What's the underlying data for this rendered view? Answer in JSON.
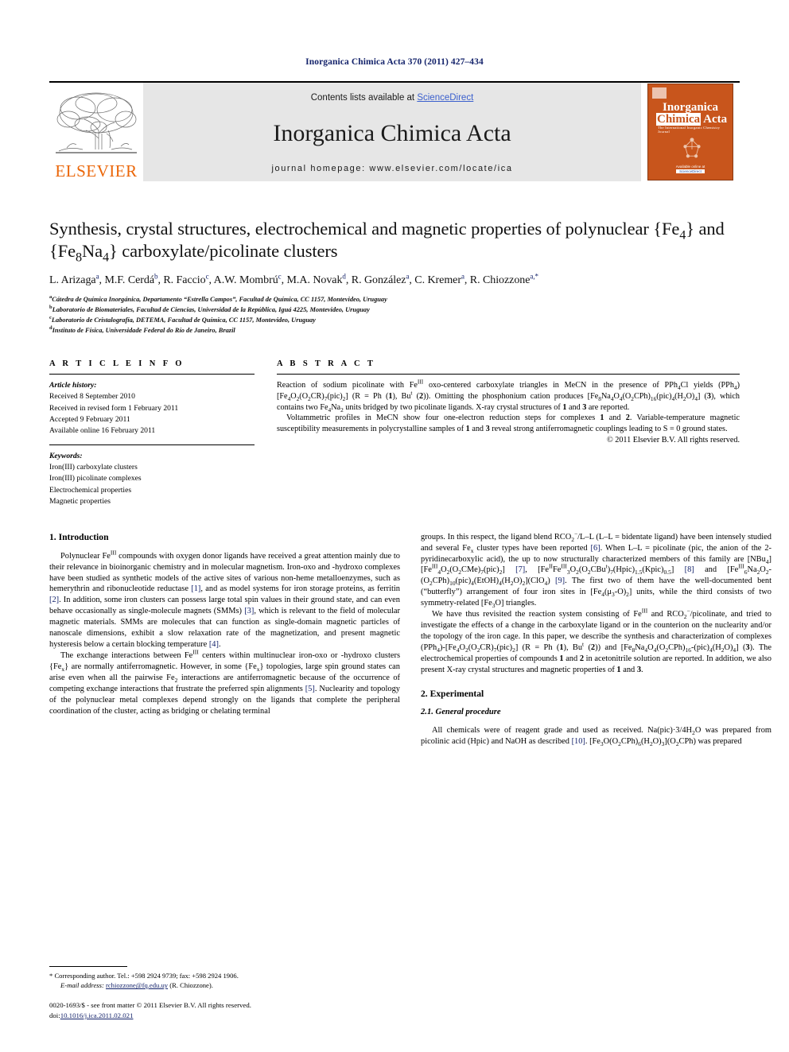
{
  "running_head": "Inorganica Chimica Acta 370 (2011) 427–434",
  "masthead": {
    "publisher": "ELSEVIER",
    "contents_prefix": "Contents lists available at ",
    "sciencedirect": "ScienceDirect",
    "journal_title": "Inorganica Chimica Acta",
    "homepage": "journal homepage: www.elsevier.com/locate/ica",
    "cover": {
      "line1": "Inorganica",
      "line2a": "Chimica",
      "line2b": "Acta",
      "tagline": "The International Inorganic Chemistry Journal",
      "available_at": "Available online at",
      "sd_box": "ScienceDirect"
    },
    "colors": {
      "banner_bg": "#e6e6e6",
      "elsevier_orange": "#eb6608",
      "sciencedirect_blue": "#3a5fcd",
      "cover_orange": "#c8551c",
      "link_navy": "#14236b"
    }
  },
  "title": "Synthesis, crystal structures, electrochemical and magnetic properties of polynuclear {Fe₄} and {Fe₈Na₄} carboxylate/picolinate clusters",
  "authors": [
    {
      "name": "L. Arizaga",
      "sup": "a"
    },
    {
      "name": "M.F. Cerdá",
      "sup": "b"
    },
    {
      "name": "R. Faccio",
      "sup": "c"
    },
    {
      "name": "A.W. Mombrú",
      "sup": "c"
    },
    {
      "name": "M.A. Novak",
      "sup": "d"
    },
    {
      "name": "R. González",
      "sup": "a"
    },
    {
      "name": "C. Kremer",
      "sup": "a"
    },
    {
      "name": "R. Chiozzone",
      "sup": "a,*"
    }
  ],
  "affiliations": [
    {
      "sup": "a",
      "text": "Cátedra de Química Inorgánica, Departamento “Estrella Campos”, Facultad de Química, CC 1157, Montevideo, Uruguay"
    },
    {
      "sup": "b",
      "text": "Laboratorio de Biomateriales, Facultad de Ciencias, Universidad de la República, Iguá 4225, Montevideo, Uruguay"
    },
    {
      "sup": "c",
      "text": "Laboratorio de Cristalografía, DETEMA, Facultad de Química, CC 1157, Montevideo, Uruguay"
    },
    {
      "sup": "d",
      "text": "Instituto de Física, Universidade Federal do Río de Janeiro, Brazil"
    }
  ],
  "article_info": {
    "heading": "A R T I C L E   I N F O",
    "history_label": "Article history:",
    "history": [
      "Received 8 September 2010",
      "Received in revised form 1 February 2011",
      "Accepted 9 February 2011",
      "Available online 16 February 2011"
    ],
    "keywords_label": "Keywords:",
    "keywords": [
      "Iron(III) carboxylate clusters",
      "Iron(III) picolinate complexes",
      "Electrochemical properties",
      "Magnetic properties"
    ]
  },
  "abstract": {
    "heading": "A B S T R A C T",
    "paragraph1": "Reaction of sodium picolinate with Feᴵᴵᴵ oxo-centered carboxylate triangles in MeCN in the presence of PPh₄Cl yields (PPh₄)[Fe₄O₂(O₂CR)₇(pic)₂] (R = Ph (1), Buᵗ (2)). Omitting the phosphonium cation produces [Fe₈Na₄O₄(O₂CPh)₁₆(pic)₄(H₂O)₄] (3), which contains two Fe₄Na₂ units bridged by two picolinate ligands. X-ray crystal structures of 1 and 3 are reported.",
    "paragraph2": "Voltammetric profiles in MeCN show four one-electron reduction steps for complexes 1 and 2. Variable-temperature magnetic susceptibility measurements in polycrystalline samples of 1 and 3 reveal strong antiferromagnetic couplings leading to S = 0 ground states.",
    "copyright": "© 2011 Elsevier B.V. All rights reserved."
  },
  "body": {
    "left": {
      "section_heading": "1. Introduction",
      "p1": "Polynuclear Feᴵᴵᴵ compounds with oxygen donor ligands have received a great attention mainly due to their relevance in bioinorganic chemistry and in molecular magnetism. Iron-oxo and -hydroxo complexes have been studied as synthetic models of the active sites of various non-heme metalloenzymes, such as hemerythrin and ribonucleotide reductase [1], and as model systems for iron storage proteins, as ferritin [2]. In addition, some iron clusters can possess large total spin values in their ground state, and can even behave occasionally as single-molecule magnets (SMMs) [3], which is relevant to the field of molecular magnetic materials. SMMs are molecules that can function as single-domain magnetic particles of nanoscale dimensions, exhibit a slow relaxation rate of the magnetization, and present magnetic hysteresis below a certain blocking temperature [4].",
      "p2": "The exchange interactions between Feᴵᴵᴵ centers within multinuclear iron-oxo or -hydroxo clusters {Feₓ} are normally antiferromagnetic. However, in some {Feₓ} topologies, large spin ground states can arise even when all the pairwise Fe₂ interactions are antiferromagnetic because of the occurrence of competing exchange interactions that frustrate the preferred spin alignments [5]. Nuclearity and topology of the polynuclear metal complexes depend strongly on the ligands that complete the peripheral coordination of the cluster, acting as bridging or chelating terminal"
    },
    "right": {
      "p1": "groups. In this respect, the ligand blend RCO₂⁻/L–L (L–L = bidentate ligand) have been intensely studied and several Feₓ cluster types have been reported [6]. When L–L = picolinate (pic, the anion of the 2-pyridinecarboxylic acid), the up to now structurally characterized members of this family are [NBu₄][Feᴵᴵᴵ₄O₂(O₂CMe)₇(pic)₂] [7], [FeᴵᴵFeᴵᴵᴵ₃O₂(O₂CBuᵗ)₇(Hpic)₁.₅(Kpic)₀.₅] [8] and [Feᴵᴵᴵ₆Na₂O₂(O₂CPh)₁₀(pic)₄(EtOH)₄(H₂O)₂](ClO₄) [9]. The first two of them have the well-documented bent (“butterfly”) arrangement of four iron sites in [Fe₄(μ₃-O)₂] units, while the third consists of two symmetry-related [Fe₃O] triangles.",
      "p2": "We have thus revisited the reaction system consisting of Feᴵᴵᴵ and RCO₂⁻/picolinate, and tried to investigate the effects of a change in the carboxylate ligand or in the counterion on the nuclearity and/or the topology of the iron cage. In this paper, we describe the synthesis and characterization of complexes (PPh₄)-[Fe₄O₂(O₂CR)₇(pic)₂] (R = Ph (1), Buᵗ (2)) and [Fe₈Na₄O₄(O₂CPh)₁₆-(pic)₄(H₂O)₄] (3). The electrochemical properties of compounds 1 and 2 in acetonitrile solution are reported. In addition, we also present X-ray crystal structures and magnetic properties of 1 and 3.",
      "section_heading": "2. Experimental",
      "subsection_heading": "2.1. General procedure",
      "p3": "All chemicals were of reagent grade and used as received. Na(pic)·3/4H₂O was prepared from picolinic acid (Hpic) and NaOH as described [10]. [Fe₃O(O₂CPh)₆(H₂O)₃](O₂CPh) was prepared"
    }
  },
  "footnotes": {
    "corresponding": "* Corresponding author. Tel.: +598 2924 9739; fax: +598 2924 1906.",
    "email_label": "E-mail address:",
    "email": "rchiozzone@fq.edu.uy",
    "email_owner": "(R. Chiozzone).",
    "issn_line": "0020-1693/$ - see front matter © 2011 Elsevier B.V. All rights reserved.",
    "doi_label": "doi:",
    "doi": "10.1016/j.ica.2011.02.021"
  }
}
